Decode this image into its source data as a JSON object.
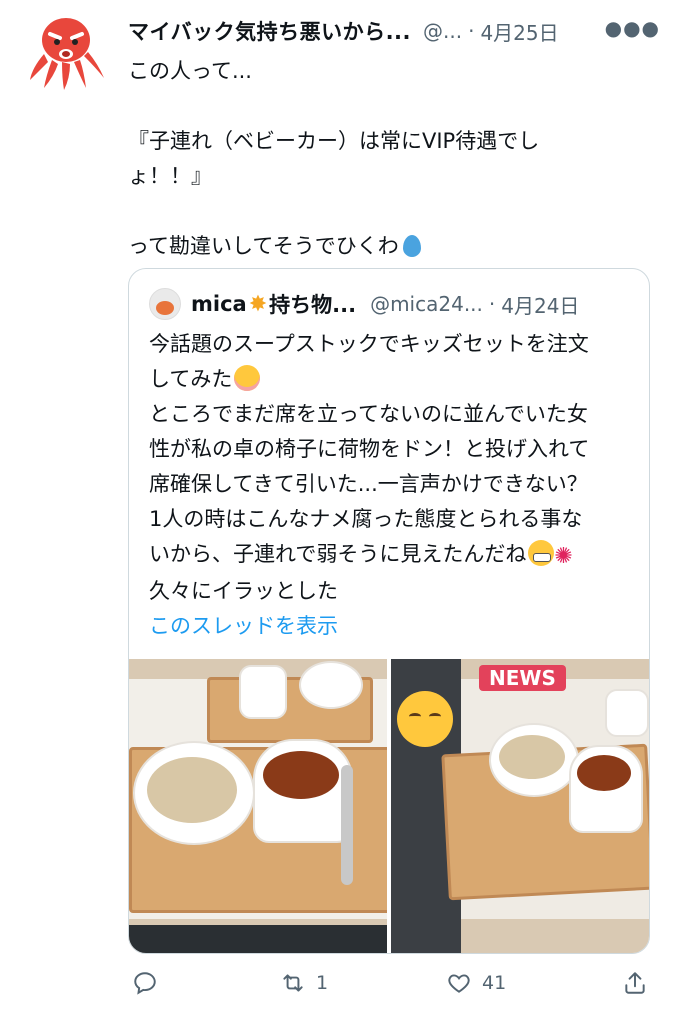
{
  "tweet": {
    "author_name": "マイバック気持ち悪いから...",
    "handle": "@...",
    "dot": "·",
    "date": "4月25日",
    "more_icon": "more-icon",
    "text_lines": [
      "この人って...",
      "",
      "『子連れ（ベビーカー）は常にVIP待遇でし",
      "ょ！！』",
      "",
      "って勘違いしてそうでひくわ"
    ]
  },
  "quote": {
    "author_name": "mica",
    "author_suffix": "持ち物...",
    "handle": "@mica24...",
    "dot": "·",
    "date": "4月24日",
    "text_lines": [
      "今話題のスープストックでキッズセットを注文",
      "してみた",
      "ところでまだ席を立ってないのに並んでいた女",
      "性が私の卓の椅子に荷物をドン！と投げ入れて",
      "席確保してきて引いた...一言声かけできない？",
      "1人の時はこんなナメ腐った態度とられる事な",
      "いから、子連れで弱そうに見えたんだね",
      "久々にイラッとした"
    ],
    "show_thread": "このスレッドを表示",
    "photo2_badge": "NEWS"
  },
  "actions": {
    "reply_count": "",
    "retweet_count": "1",
    "like_count": "41"
  },
  "colors": {
    "link": "#1d9bf0",
    "muted": "#536471",
    "border": "#cfd9de"
  }
}
